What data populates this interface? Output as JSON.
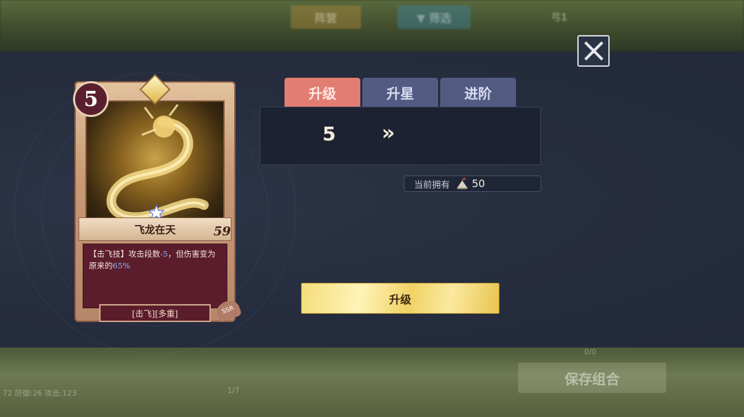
{
  "background": {
    "top_buttons": [
      "阵营",
      "▼ 筛选"
    ],
    "top_player": "弓1",
    "bottom_save": "保存组合",
    "bottom_count": "1/7",
    "bottom_stats": "72 防御:26 攻击:123",
    "bottom_page": "0/0"
  },
  "card": {
    "cost": "5",
    "name": "飞龙在天",
    "power": "59",
    "desc_prefix": "【击飞技】攻击段数",
    "desc_minus": "-5",
    "desc_mid": "，但伤害变为原来的",
    "desc_percent": "65%",
    "tags": "[击飞][多重]",
    "seal": "SSR"
  },
  "tabs": [
    {
      "label": "升级",
      "active": true
    },
    {
      "label": "升星",
      "active": false
    },
    {
      "label": "进阶",
      "active": false
    }
  ],
  "level": {
    "current": "5",
    "arrow": "»"
  },
  "owned": {
    "label": "当前拥有",
    "value": "50",
    "icon": "scroll-icon"
  },
  "upgrade_button": "升级",
  "colors": {
    "tab_active": "#e27d72",
    "tab_inactive": "#525b82",
    "upgrade_gold": "#f0d264"
  }
}
